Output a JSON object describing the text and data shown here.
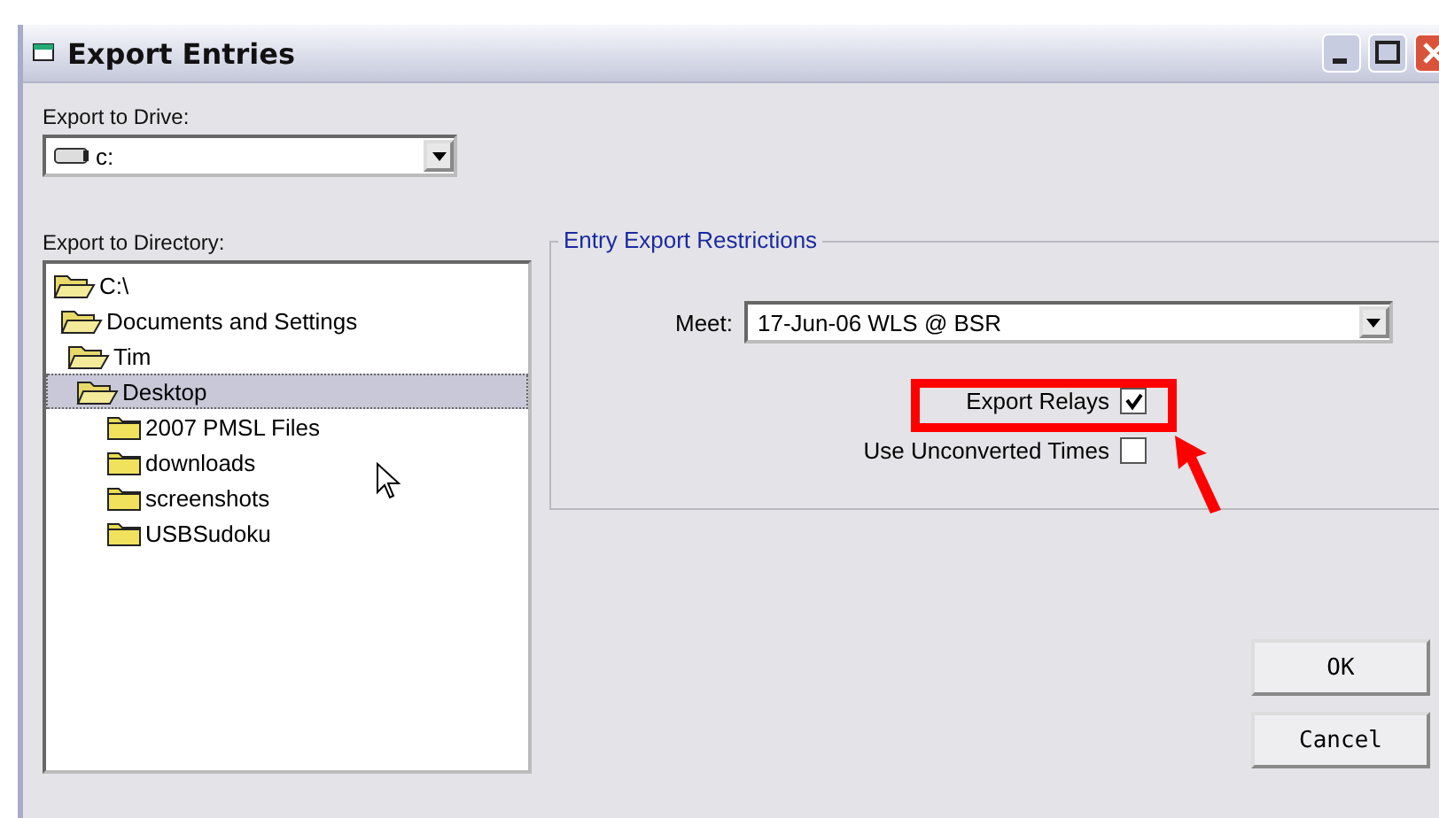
{
  "window": {
    "title": "Export Entries"
  },
  "drive": {
    "label": "Export to Drive:",
    "value": "c:"
  },
  "directory": {
    "label": "Export to Directory:",
    "tree": [
      {
        "label": "C:\\",
        "selected": false,
        "children": [
          {
            "label": "Documents and Settings",
            "selected": false,
            "children": [
              {
                "label": "Tim",
                "selected": false,
                "children": [
                  {
                    "label": "Desktop",
                    "selected": true,
                    "children": [
                      {
                        "label": "2007 PMSL Files",
                        "selected": false
                      },
                      {
                        "label": "downloads",
                        "selected": false
                      },
                      {
                        "label": "screenshots",
                        "selected": false
                      },
                      {
                        "label": "USBSudoku",
                        "selected": false
                      }
                    ]
                  }
                ]
              }
            ]
          }
        ]
      }
    ]
  },
  "restrictions": {
    "title": "Entry Export Restrictions",
    "meet_label": "Meet:",
    "meet_value": "17-Jun-06 WLS @ BSR",
    "options": [
      {
        "label": "Export Relays",
        "checked": true
      },
      {
        "label": "Use Unconverted Times",
        "checked": false
      }
    ]
  },
  "buttons": [
    "OK",
    "Cancel"
  ]
}
